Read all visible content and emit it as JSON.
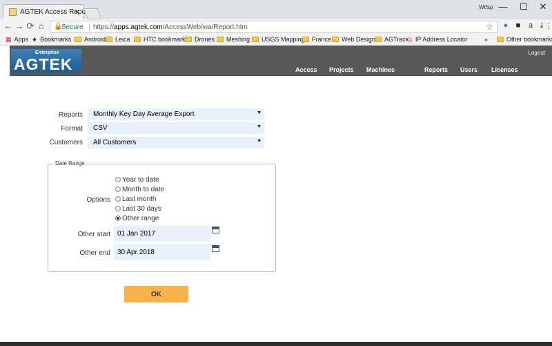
{
  "browser": {
    "tab_title": "AGTEK Access Reports",
    "tab_close": "×",
    "profile": "Wtfsp",
    "window_controls": {
      "minimize": "—",
      "maximize": "☐",
      "close": "✕"
    },
    "nav": {
      "back": "←",
      "forward": "→",
      "reload": "⟳",
      "home": "⌂"
    },
    "secure_label": "Secure",
    "url_scheme": "https://",
    "url_host": "apps.agtek.com",
    "url_path": "/AccessWeb/wa/Report.htm",
    "bookmarks": [
      "Apps",
      "Bookmarks",
      "Android",
      "Leica",
      "HTC bookmarks",
      "Drones",
      "Meshing",
      "USGS Mapping",
      "France",
      "Web Design",
      "AGTrack",
      "IP Address Locator",
      "»",
      "Other bookmarks"
    ]
  },
  "header": {
    "logo_top": "Enterprise",
    "logo_main": "AGTEK",
    "logout": "Logout",
    "nav": [
      "Access",
      "Projects",
      "Machines",
      "Reports",
      "Users",
      "Licenses"
    ]
  },
  "form": {
    "reports_label": "Reports",
    "reports_value": "Monthly Key Day Average Export",
    "format_label": "Format",
    "format_value": "CSV",
    "customers_label": "Customers",
    "customers_value": "All Customers",
    "date_range_legend": "Date Range",
    "options_label": "Options",
    "options": [
      {
        "label": "Year to date",
        "checked": false
      },
      {
        "label": "Month to date",
        "checked": false
      },
      {
        "label": "Last month",
        "checked": false
      },
      {
        "label": "Last 30 days",
        "checked": false
      },
      {
        "label": "Other range",
        "checked": true
      }
    ],
    "other_start_label": "Other start",
    "other_start_value": "01 Jan 2017",
    "other_end_label": "Other end",
    "other_end_value": "30 Apr 2018",
    "ok_label": "OK"
  },
  "colors": {
    "header_bg": "#585858",
    "field_bg": "#e6f1fb",
    "ok_button": "#f7b24a",
    "logo_blue": "#2a6aa3"
  }
}
